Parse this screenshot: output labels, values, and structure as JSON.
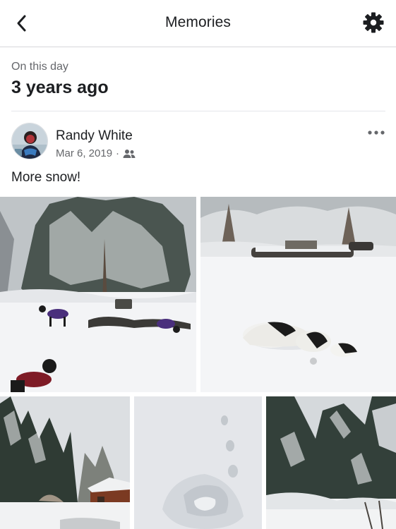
{
  "header": {
    "title": "Memories",
    "back_icon": "chevron-left-icon",
    "settings_icon": "gear-icon"
  },
  "section": {
    "label": "On this day",
    "heading": "3 years ago"
  },
  "post": {
    "author": "Randy White",
    "date": "Mar 6, 2019",
    "separator": "·",
    "audience_icon": "friends-icon",
    "more_icon": "more-options-icon",
    "caption": "More snow!",
    "photos": [
      {
        "name": "photo-dogs-in-snow-yard"
      },
      {
        "name": "photo-dog-rolling-in-snow"
      },
      {
        "name": "photo-snowy-trees-cabin"
      },
      {
        "name": "photo-footprints-in-snow"
      },
      {
        "name": "photo-snowy-evergreen-trees"
      }
    ]
  },
  "colors": {
    "text_primary": "#1c1e21",
    "text_secondary": "#65676b",
    "divider": "#e4e6eb"
  }
}
